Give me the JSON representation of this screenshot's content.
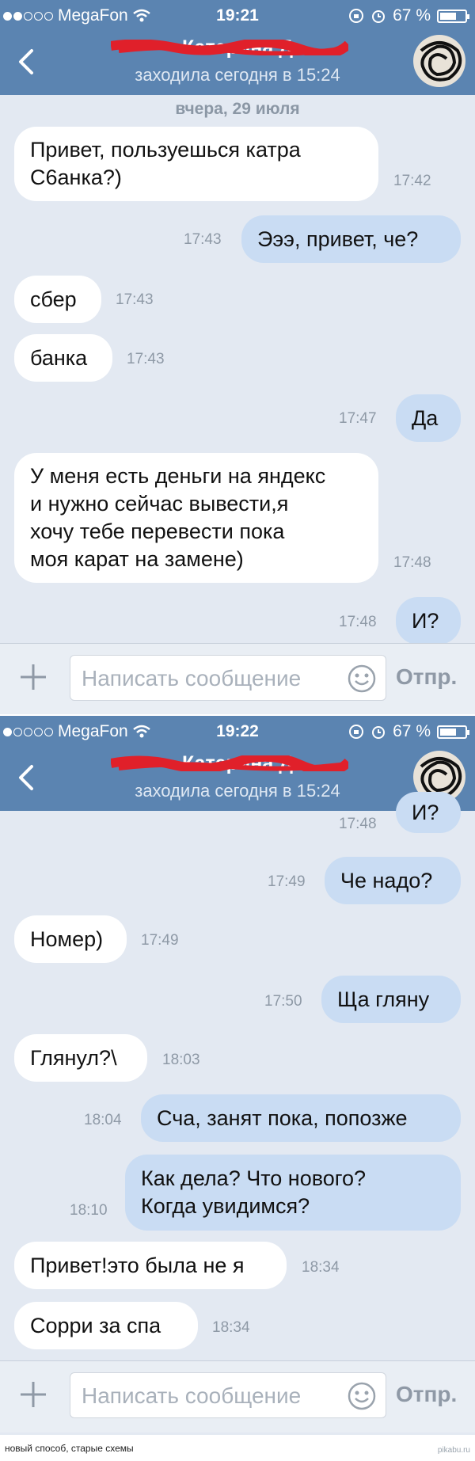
{
  "screens": [
    {
      "status": {
        "carrier": "MegaFon",
        "time": "19:21",
        "battery": "67 %"
      },
      "nav": {
        "title": "Катерина Д",
        "subtitle": "заходила сегодня в 15:24"
      },
      "date_separator": "вчера, 29 июля",
      "messages": [
        {
          "dir": "in",
          "text": "Привет, пользуешься катра\nС6анка?)",
          "time": "17:42"
        },
        {
          "dir": "out",
          "text": "Эээ, привет, че?",
          "time": "17:43"
        },
        {
          "dir": "in",
          "text": "сбер",
          "time": "17:43"
        },
        {
          "dir": "in",
          "text": "банка",
          "time": "17:43"
        },
        {
          "dir": "out",
          "text": "Да",
          "time": "17:47"
        },
        {
          "dir": "in",
          "text": "У меня есть деньги на яндекс\nи нужно сейчас вывести,я\nхочу тебе перевести пока\nмоя карат на замене)",
          "time": "17:48"
        },
        {
          "dir": "out",
          "text": "И?",
          "time": "17:48"
        }
      ],
      "input": {
        "placeholder": "Написать сообщение",
        "send_label": "Отпр."
      }
    },
    {
      "status": {
        "carrier": "MegaFon",
        "time": "19:22",
        "battery": "67 %"
      },
      "nav": {
        "title": "Катерина Д",
        "subtitle": "заходила сегодня в 15:24"
      },
      "messages": [
        {
          "dir": "out",
          "text": "И?",
          "time": "17:48"
        },
        {
          "dir": "out",
          "text": "Че надо?",
          "time": "17:49"
        },
        {
          "dir": "in",
          "text": "Номер)",
          "time": "17:49"
        },
        {
          "dir": "out",
          "text": "Ща гляну",
          "time": "17:50"
        },
        {
          "dir": "in",
          "text": "Глянул?\\",
          "time": "18:03"
        },
        {
          "dir": "out",
          "text": "Сча, занят пока, попозже",
          "time": "18:04"
        },
        {
          "dir": "out",
          "text": "Как дела? Что нового?\nКогда увидимся?",
          "time": "18:10"
        },
        {
          "dir": "in",
          "text": "Привет!это была не я",
          "time": "18:34"
        },
        {
          "dir": "in",
          "text": "Сорри за спа",
          "time": "18:34"
        }
      ],
      "input": {
        "placeholder": "Написать сообщение",
        "send_label": "Отпр."
      }
    }
  ],
  "caption": "новый способ, старые схемы",
  "watermark": "pikabu.ru",
  "colors": {
    "nav_bg": "#5b84b1",
    "chat_bg": "#e3e9f2",
    "bubble_out": "#c9dcf3",
    "bubble_in": "#ffffff",
    "redaction": "#e0202a"
  },
  "icons": [
    "back-arrow-icon",
    "wifi-icon",
    "lock-rotation-icon",
    "alarm-icon",
    "battery-icon",
    "plus-icon",
    "smile-icon"
  ]
}
